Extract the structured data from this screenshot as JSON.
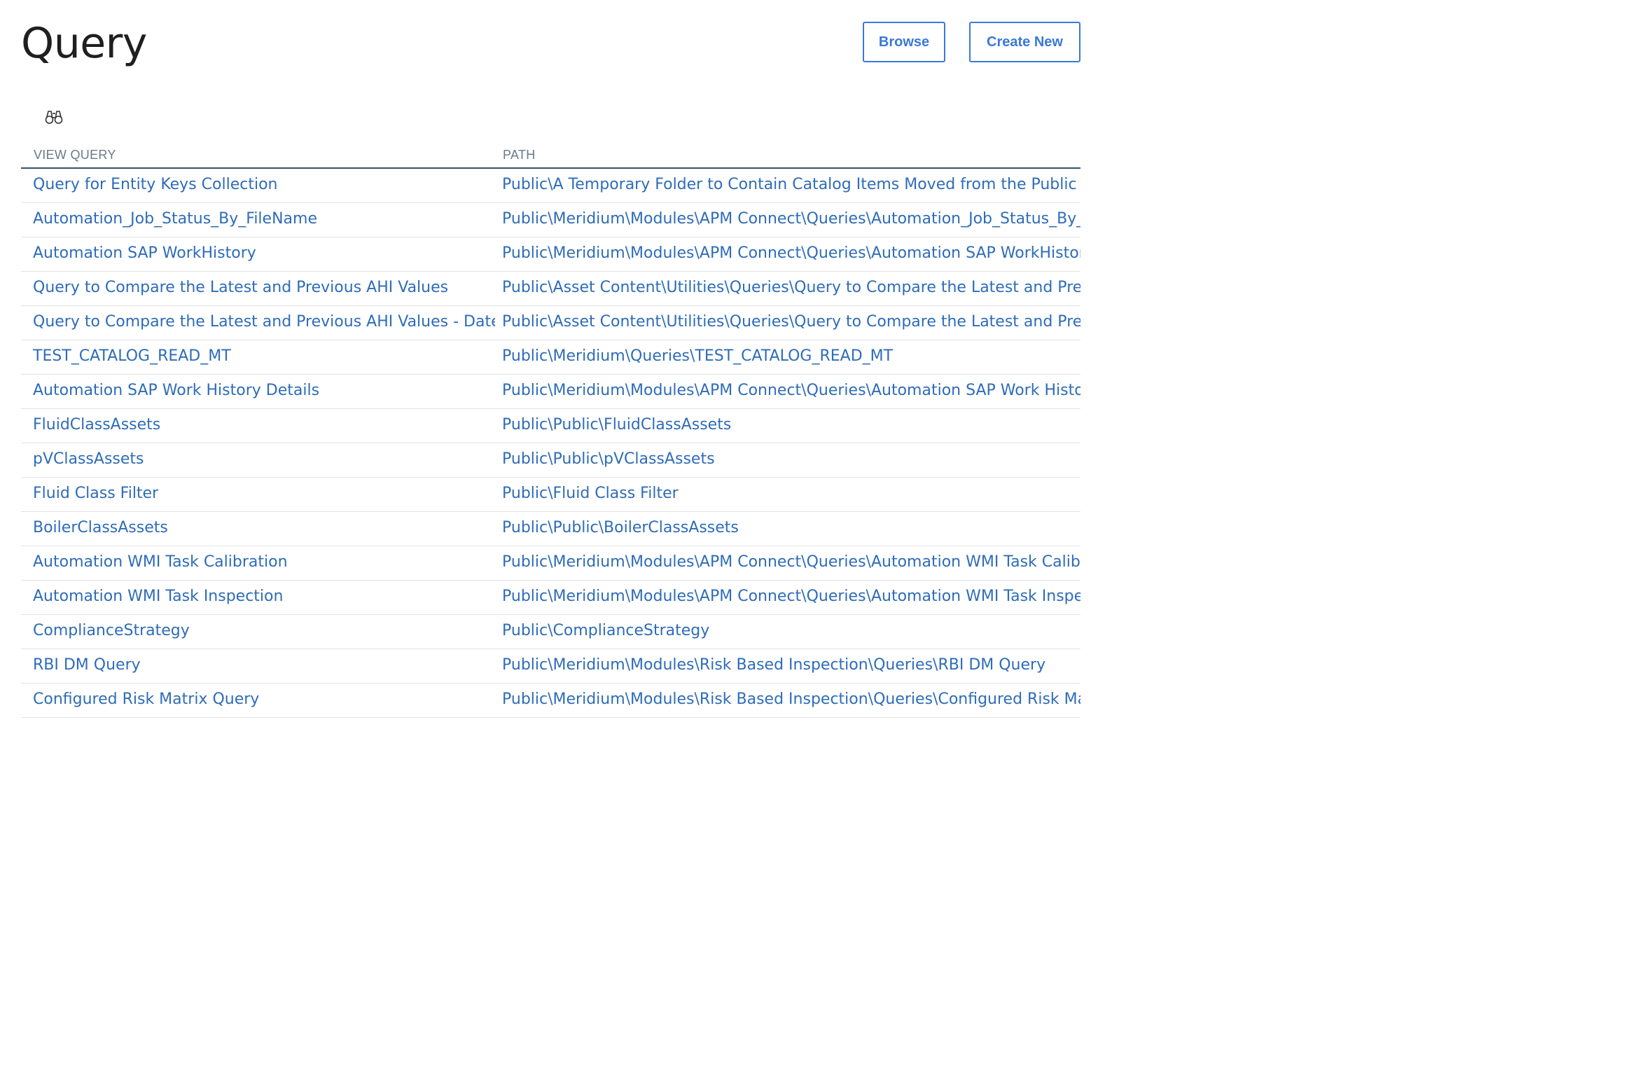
{
  "page": {
    "title": "Query"
  },
  "actions": {
    "browse_label": "Browse",
    "create_new_label": "Create New"
  },
  "toolbar": {
    "search_icon": "binoculars-icon"
  },
  "table": {
    "columns": [
      "VIEW QUERY",
      "PATH"
    ],
    "rows": [
      {
        "name": "Query for Entity Keys Collection",
        "path": "Public\\A Temporary Folder to Contain Catalog Items Moved from the Public Folder"
      },
      {
        "name": "Automation_Job_Status_By_FileName",
        "path": "Public\\Meridium\\Modules\\APM Connect\\Queries\\Automation_Job_Status_By_FileName"
      },
      {
        "name": "Automation SAP WorkHistory",
        "path": "Public\\Meridium\\Modules\\APM Connect\\Queries\\Automation SAP WorkHistory"
      },
      {
        "name": "Query to Compare the Latest and Previous AHI Values",
        "path": "Public\\Asset Content\\Utilities\\Queries\\Query to Compare the Latest and Previous AHI Values"
      },
      {
        "name": "Query to Compare the Latest and Previous AHI Values - Date",
        "path": "Public\\Asset Content\\Utilities\\Queries\\Query to Compare the Latest and Previous AHI Values - Date"
      },
      {
        "name": "TEST_CATALOG_READ_MT",
        "path": "Public\\Meridium\\Queries\\TEST_CATALOG_READ_MT"
      },
      {
        "name": "Automation SAP Work History Details",
        "path": "Public\\Meridium\\Modules\\APM Connect\\Queries\\Automation SAP Work History Details"
      },
      {
        "name": "FluidClassAssets",
        "path": "Public\\Public\\FluidClassAssets"
      },
      {
        "name": "pVClassAssets",
        "path": "Public\\Public\\pVClassAssets"
      },
      {
        "name": "Fluid Class Filter",
        "path": "Public\\Fluid Class Filter"
      },
      {
        "name": "BoilerClassAssets",
        "path": "Public\\Public\\BoilerClassAssets"
      },
      {
        "name": "Automation WMI Task Calibration",
        "path": "Public\\Meridium\\Modules\\APM Connect\\Queries\\Automation WMI Task Calibration"
      },
      {
        "name": "Automation WMI Task Inspection",
        "path": "Public\\Meridium\\Modules\\APM Connect\\Queries\\Automation WMI Task Inspection"
      },
      {
        "name": "ComplianceStrategy",
        "path": "Public\\ComplianceStrategy"
      },
      {
        "name": "RBI DM Query",
        "path": "Public\\Meridium\\Modules\\Risk Based Inspection\\Queries\\RBI DM Query"
      },
      {
        "name": "Configured Risk Matrix Query",
        "path": "Public\\Meridium\\Modules\\Risk Based Inspection\\Queries\\Configured Risk Matrix Query"
      }
    ]
  },
  "colors": {
    "link": "#2e6cb8",
    "accent": "#3a79d8",
    "header_rule": "#35506d",
    "row_rule": "#e2e2e2"
  }
}
